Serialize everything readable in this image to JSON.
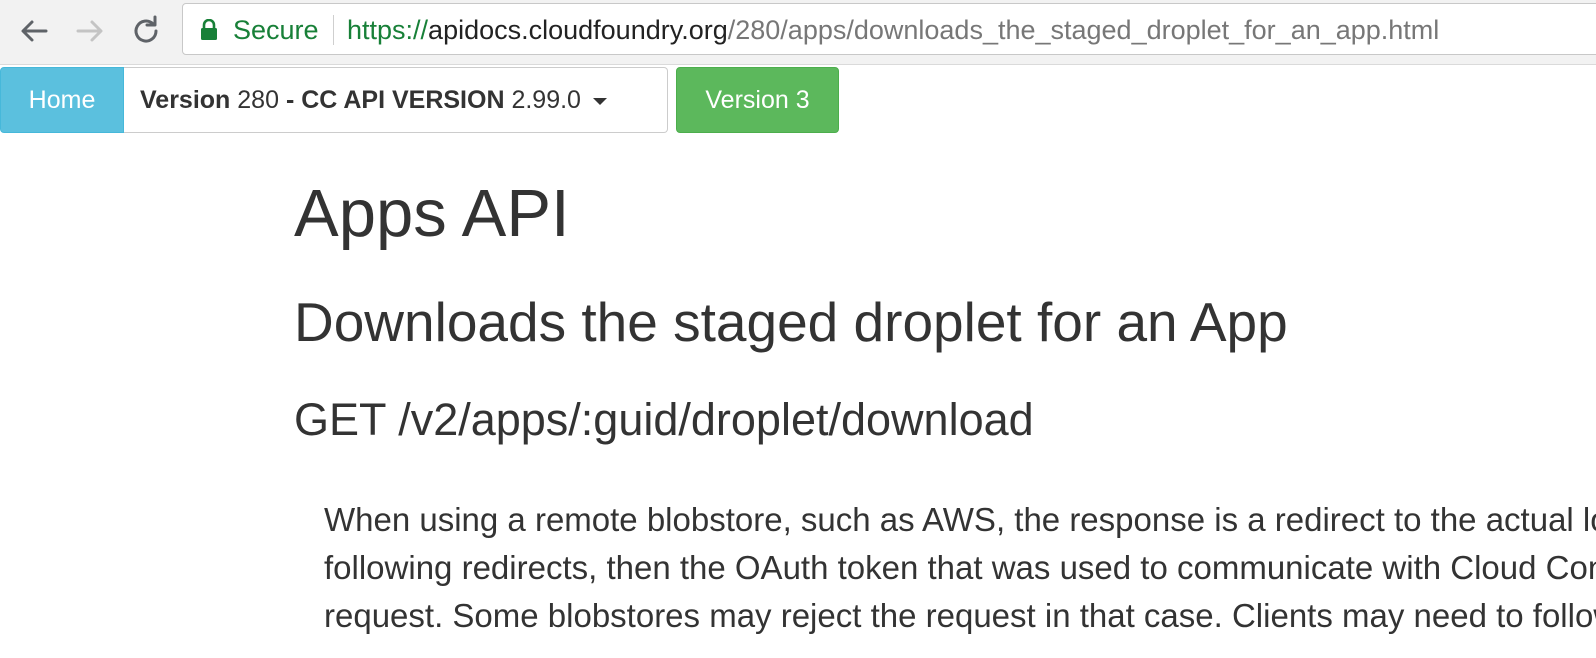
{
  "browser": {
    "security_label": "Secure",
    "url": {
      "scheme": "https://",
      "host": "apidocs.cloudfoundry.org",
      "path": "/280/apps/downloads_the_staged_droplet_for_an_app.html"
    }
  },
  "toolbar": {
    "home_label": "Home",
    "version": {
      "label_bold": "Version",
      "number": "280",
      "cc_label_bold": "- CC API VERSION",
      "cc_version": "2.99.0"
    },
    "version3_label": "Version 3"
  },
  "page": {
    "title": "Apps API",
    "endpoint_title": "Downloads the staged droplet for an App",
    "endpoint_path": "GET /v2/apps/:guid/droplet/download",
    "description_lines": [
      "When using a remote blobstore, such as AWS, the response is a redirect to the actual location of the bits. If the client is automatically",
      "following redirects, then the OAuth token that was used to communicate with Cloud Controller will be relayed on the new redirect",
      "request. Some blobstores may reject the request in that case. Clients may need to follow the redirect without including the OAuth token."
    ]
  },
  "colors": {
    "secure_green": "#188038",
    "home_button": "#5bc0de",
    "version3_button": "#5cb85c",
    "text": "#333333"
  },
  "icons": {
    "back": "arrow-left-icon",
    "forward": "arrow-right-icon",
    "reload": "reload-icon",
    "lock": "lock-icon",
    "dropdown": "caret-down-icon"
  }
}
